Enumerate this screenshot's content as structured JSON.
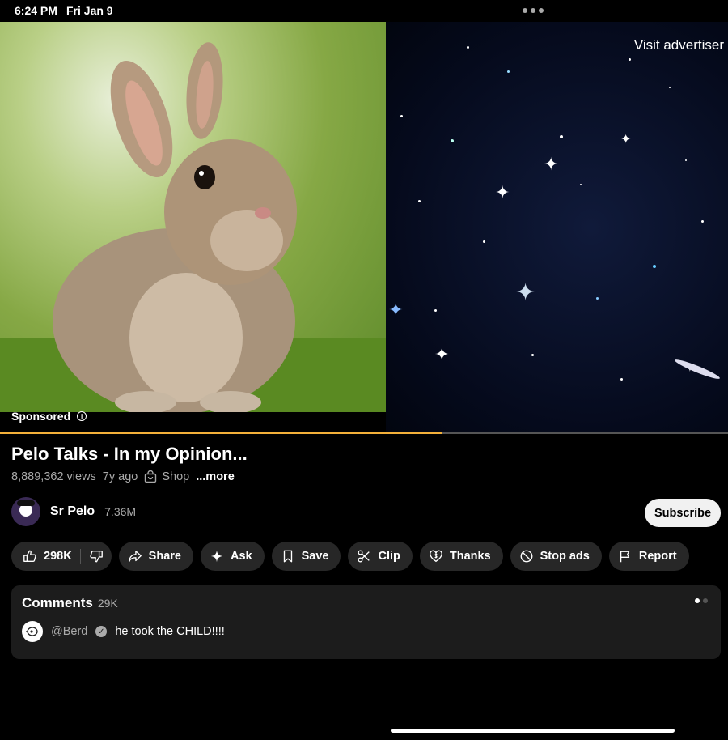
{
  "status": {
    "time": "6:24 PM",
    "date": "Fri Jan 9"
  },
  "ad": {
    "visit_label": "Visit advertiser",
    "sponsored_label": "Sponsored",
    "info_glyph": "i",
    "progress_fraction": 0.607
  },
  "video": {
    "title": "Pelo Talks - In my Opinion...",
    "views": "8,889,362 views",
    "age": "7y ago",
    "shop_label": "Shop",
    "more_label": "...more"
  },
  "channel": {
    "name": "Sr Pelo",
    "subscribers": "7.36M",
    "subscribe_label": "Subscribe"
  },
  "actions": {
    "likes": "298K",
    "share": "Share",
    "ask": "Ask",
    "save": "Save",
    "clip": "Clip",
    "thanks": "Thanks",
    "stop_ads": "Stop ads",
    "report": "Report"
  },
  "comments": {
    "label": "Comments",
    "count": "29K",
    "top": {
      "user": "@Berd",
      "text": "he took the CHILD!!!!"
    }
  },
  "colors": {
    "progress": "#f3b03a",
    "pill_bg": "#272727",
    "comments_bg": "#1c1c1c"
  }
}
